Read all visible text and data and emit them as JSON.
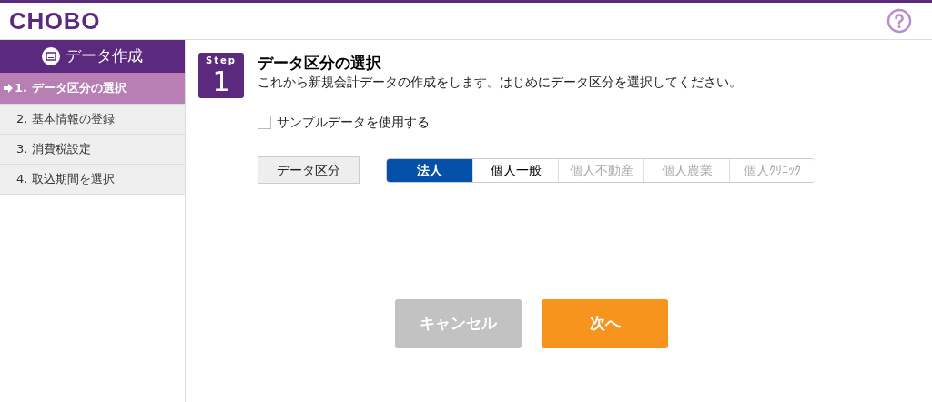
{
  "header": {
    "logo": "CHOBO"
  },
  "sidebar": {
    "title": "データ作成",
    "items": [
      {
        "label": "1. データ区分の選択",
        "selected": true
      },
      {
        "label": "2. 基本情報の登録",
        "selected": false
      },
      {
        "label": "3. 消費税設定",
        "selected": false
      },
      {
        "label": "4. 取込期間を選択",
        "selected": false
      }
    ]
  },
  "step": {
    "caption": "Step",
    "number": "1",
    "title": "データ区分の選択",
    "description": "これから新規会計データの作成をします。はじめにデータ区分を選択してください。"
  },
  "sample_checkbox": {
    "label": "サンプルデータを使用する",
    "checked": false
  },
  "data_type": {
    "label": "データ区分",
    "options": [
      {
        "label": "法人",
        "selected": true,
        "disabled": false
      },
      {
        "label": "個人一般",
        "selected": false,
        "disabled": false
      },
      {
        "label": "個人不動産",
        "selected": false,
        "disabled": true
      },
      {
        "label": "個人農業",
        "selected": false,
        "disabled": true
      },
      {
        "label": "個人ｸﾘﾆｯｸ",
        "selected": false,
        "disabled": true
      }
    ]
  },
  "buttons": [
    {
      "label": "キャンセル",
      "kind": "cancel",
      "disabled": true
    },
    {
      "label": "次へ",
      "kind": "next",
      "disabled": false
    }
  ]
}
